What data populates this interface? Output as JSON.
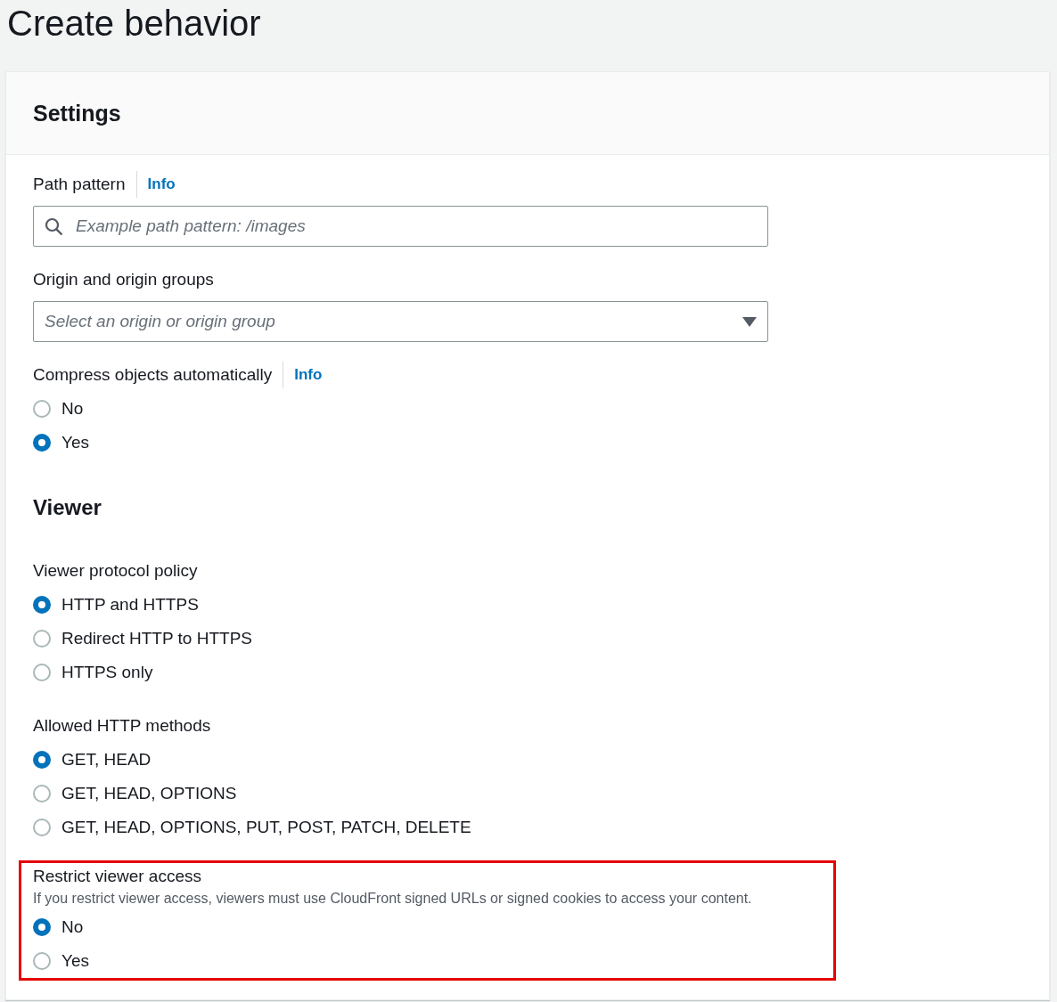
{
  "page_title": "Create behavior",
  "card": {
    "title": "Settings",
    "fields": [
      {
        "kind": "search",
        "label": "Path pattern",
        "info": "Info",
        "placeholder": "Example path pattern: /images"
      },
      {
        "kind": "select",
        "label": "Origin and origin groups",
        "placeholder": "Select an origin or origin group"
      },
      {
        "kind": "radio",
        "label": "Compress objects automatically",
        "info": "Info",
        "options": [
          {
            "label": "No",
            "selected": false
          },
          {
            "label": "Yes",
            "selected": true
          }
        ]
      },
      {
        "kind": "heading",
        "label": "Viewer"
      },
      {
        "kind": "radio",
        "label": "Viewer protocol policy",
        "options": [
          {
            "label": "HTTP and HTTPS",
            "selected": true
          },
          {
            "label": "Redirect HTTP to HTTPS",
            "selected": false
          },
          {
            "label": "HTTPS only",
            "selected": false
          }
        ]
      },
      {
        "kind": "radio",
        "label": "Allowed HTTP methods",
        "options": [
          {
            "label": "GET, HEAD",
            "selected": true
          },
          {
            "label": "GET, HEAD, OPTIONS",
            "selected": false
          },
          {
            "label": "GET, HEAD, OPTIONS, PUT, POST, PATCH, DELETE",
            "selected": false
          }
        ]
      },
      {
        "kind": "radio",
        "label": "Restrict viewer access",
        "highlighted": true,
        "description": "If you restrict viewer access, viewers must use CloudFront signed URLs or signed cookies to access your content.",
        "options": [
          {
            "label": "No",
            "selected": true
          },
          {
            "label": "Yes",
            "selected": false
          }
        ]
      }
    ]
  }
}
